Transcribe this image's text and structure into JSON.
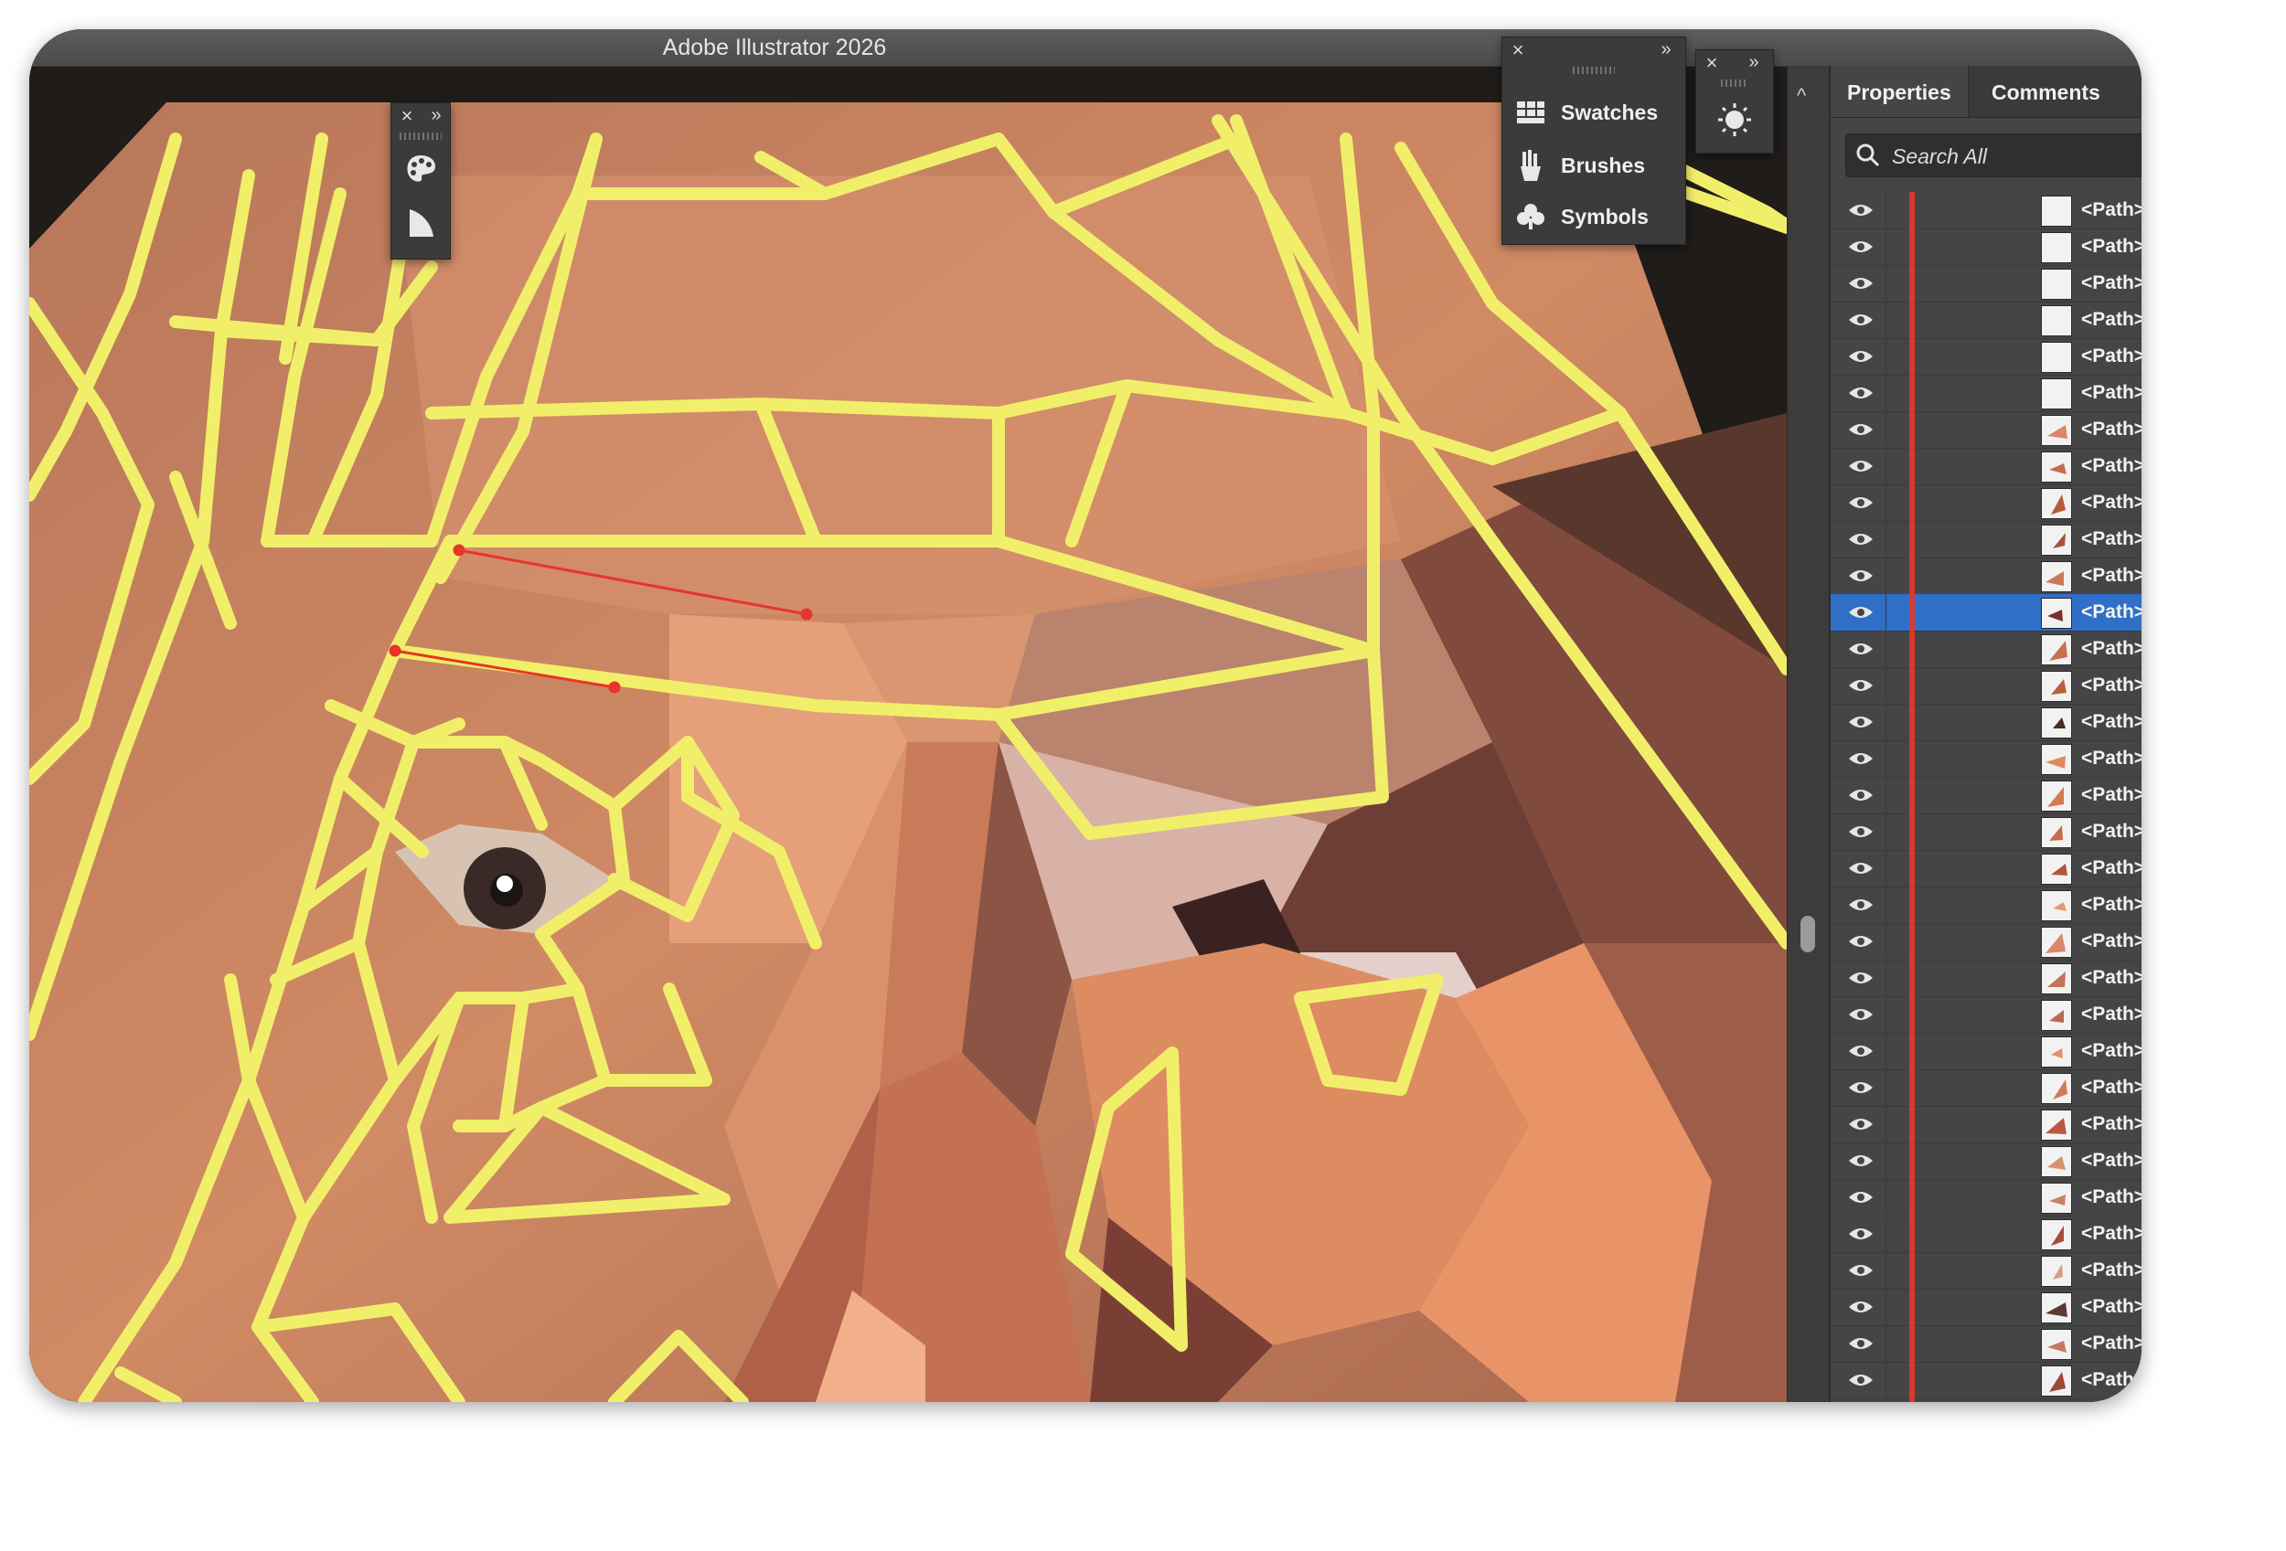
{
  "app": {
    "title": "Adobe Illustrator 2026"
  },
  "floating_tools": {
    "close_glyph": "×",
    "collapse_glyph": "»",
    "icons": [
      "palette-icon",
      "gradient-icon"
    ]
  },
  "library_panel": {
    "close_glyph": "×",
    "collapse_glyph": "»",
    "items": [
      {
        "label": "Swatches",
        "icon": "swatches-icon"
      },
      {
        "label": "Brushes",
        "icon": "brushes-icon"
      },
      {
        "label": "Symbols",
        "icon": "symbols-icon"
      }
    ]
  },
  "appearance_panel": {
    "close_glyph": "×",
    "collapse_glyph": "»",
    "icon": "sun-icon"
  },
  "right_panel": {
    "tabs": [
      "Properties",
      "Comments"
    ],
    "search_placeholder": "Search All",
    "scroll_up_glyph": "^",
    "layers": [
      {
        "label": "<Path>",
        "selected": false
      },
      {
        "label": "<Path>",
        "selected": false
      },
      {
        "label": "<Path>",
        "selected": false
      },
      {
        "label": "<Path>",
        "selected": false
      },
      {
        "label": "<Path>",
        "selected": false
      },
      {
        "label": "<Path>",
        "selected": false
      },
      {
        "label": "<Path>",
        "selected": false
      },
      {
        "label": "<Path>",
        "selected": false
      },
      {
        "label": "<Path>",
        "selected": false
      },
      {
        "label": "<Path>",
        "selected": false
      },
      {
        "label": "<Path>",
        "selected": false
      },
      {
        "label": "<Path>",
        "selected": true
      },
      {
        "label": "<Path>",
        "selected": false
      },
      {
        "label": "<Path>",
        "selected": false
      },
      {
        "label": "<Path>",
        "selected": false
      },
      {
        "label": "<Path>",
        "selected": false
      },
      {
        "label": "<Path>",
        "selected": false
      },
      {
        "label": "<Path>",
        "selected": false
      },
      {
        "label": "<Path>",
        "selected": false
      },
      {
        "label": "<Path>",
        "selected": false
      },
      {
        "label": "<Path>",
        "selected": false
      },
      {
        "label": "<Path>",
        "selected": false
      },
      {
        "label": "<Path>",
        "selected": false
      },
      {
        "label": "<Path>",
        "selected": false
      },
      {
        "label": "<Path>",
        "selected": false
      },
      {
        "label": "<Path>",
        "selected": false
      },
      {
        "label": "<Path>",
        "selected": false
      },
      {
        "label": "<Path>",
        "selected": false
      },
      {
        "label": "<Path>",
        "selected": false
      },
      {
        "label": "<Path>",
        "selected": false
      },
      {
        "label": "<Path>",
        "selected": false
      },
      {
        "label": "<Path>",
        "selected": false
      },
      {
        "label": "<Path>",
        "selected": false
      }
    ]
  },
  "colors": {
    "mesh_outline": "#f1ef6a",
    "selection": "#2f6fc7",
    "layer_color_bar": "#e7352a",
    "panel_bg": "#454545"
  }
}
